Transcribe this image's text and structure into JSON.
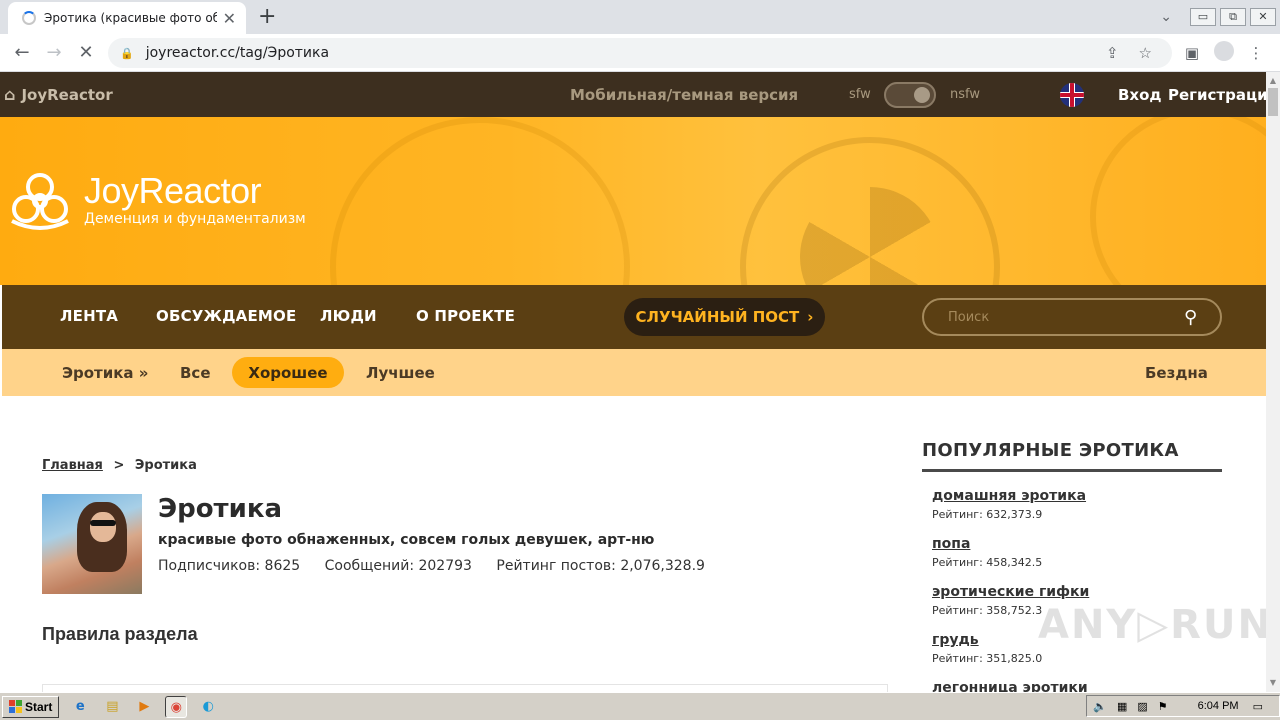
{
  "browser": {
    "tab_title": "Эротика (красивые фото обнажен",
    "tab_close": "✕",
    "new_tab": "+",
    "url": "joyreactor.cc/tag/Эротика"
  },
  "site": {
    "topbar": {
      "home_label": "JoyReactor",
      "mobile_label": "Мобильная/темная версия",
      "sfw_label": "sfw",
      "nsfw_label": "nsfw",
      "login_label": "Вход",
      "register_label": "Регистрация"
    },
    "banner": {
      "logo_title": "JoyReactor",
      "logo_subtitle": "Деменция и фундаментализм"
    },
    "main_nav": {
      "items": [
        "ЛЕНТА",
        "ОБСУЖДАЕМОЕ",
        "ЛЮДИ",
        "О ПРОЕКТЕ"
      ],
      "random_label": "СЛУЧАЙНЫЙ ПОСТ",
      "search_placeholder": "Поиск"
    },
    "sub_nav": {
      "tag_label": "Эротика »",
      "all_label": "Все",
      "good_label": "Хорошее",
      "best_label": "Лучшее",
      "abyss_label": "Бездна"
    },
    "breadcrumb": {
      "home": "Главная",
      "separator": ">",
      "current": "Эротика"
    },
    "tag": {
      "title": "Эротика",
      "description": "красивые фото обнаженных, совсем голых девушек, арт-ню",
      "subscribers": "Подписчиков: 8625",
      "messages": "Сообщений: 202793",
      "rating": "Рейтинг постов: 2,076,328.9"
    },
    "rules_title": "Правила раздела",
    "sidebar": {
      "title": "ПОПУЛЯРНЫЕ ЭРОТИКА",
      "items": [
        {
          "name": "домашняя эротика",
          "rating": "Рейтинг: 632,373.9"
        },
        {
          "name": "попа",
          "rating": "Рейтинг: 458,342.5"
        },
        {
          "name": "эротические гифки",
          "rating": "Рейтинг: 358,752.3"
        },
        {
          "name": "грудь",
          "rating": "Рейтинг: 351,825.0"
        },
        {
          "name": "легонница эротики",
          "rating": ""
        }
      ]
    }
  },
  "watermark": "ANY▷RUN",
  "taskbar": {
    "start_label": "Start",
    "clock": "6:04 PM"
  },
  "colors": {
    "topbar_bg": "#3d2f1f",
    "banner_orange": "#ffb524",
    "main_nav_bg": "#5b3f13",
    "sub_nav_bg": "#ffd38a",
    "accent": "#ffad10"
  }
}
